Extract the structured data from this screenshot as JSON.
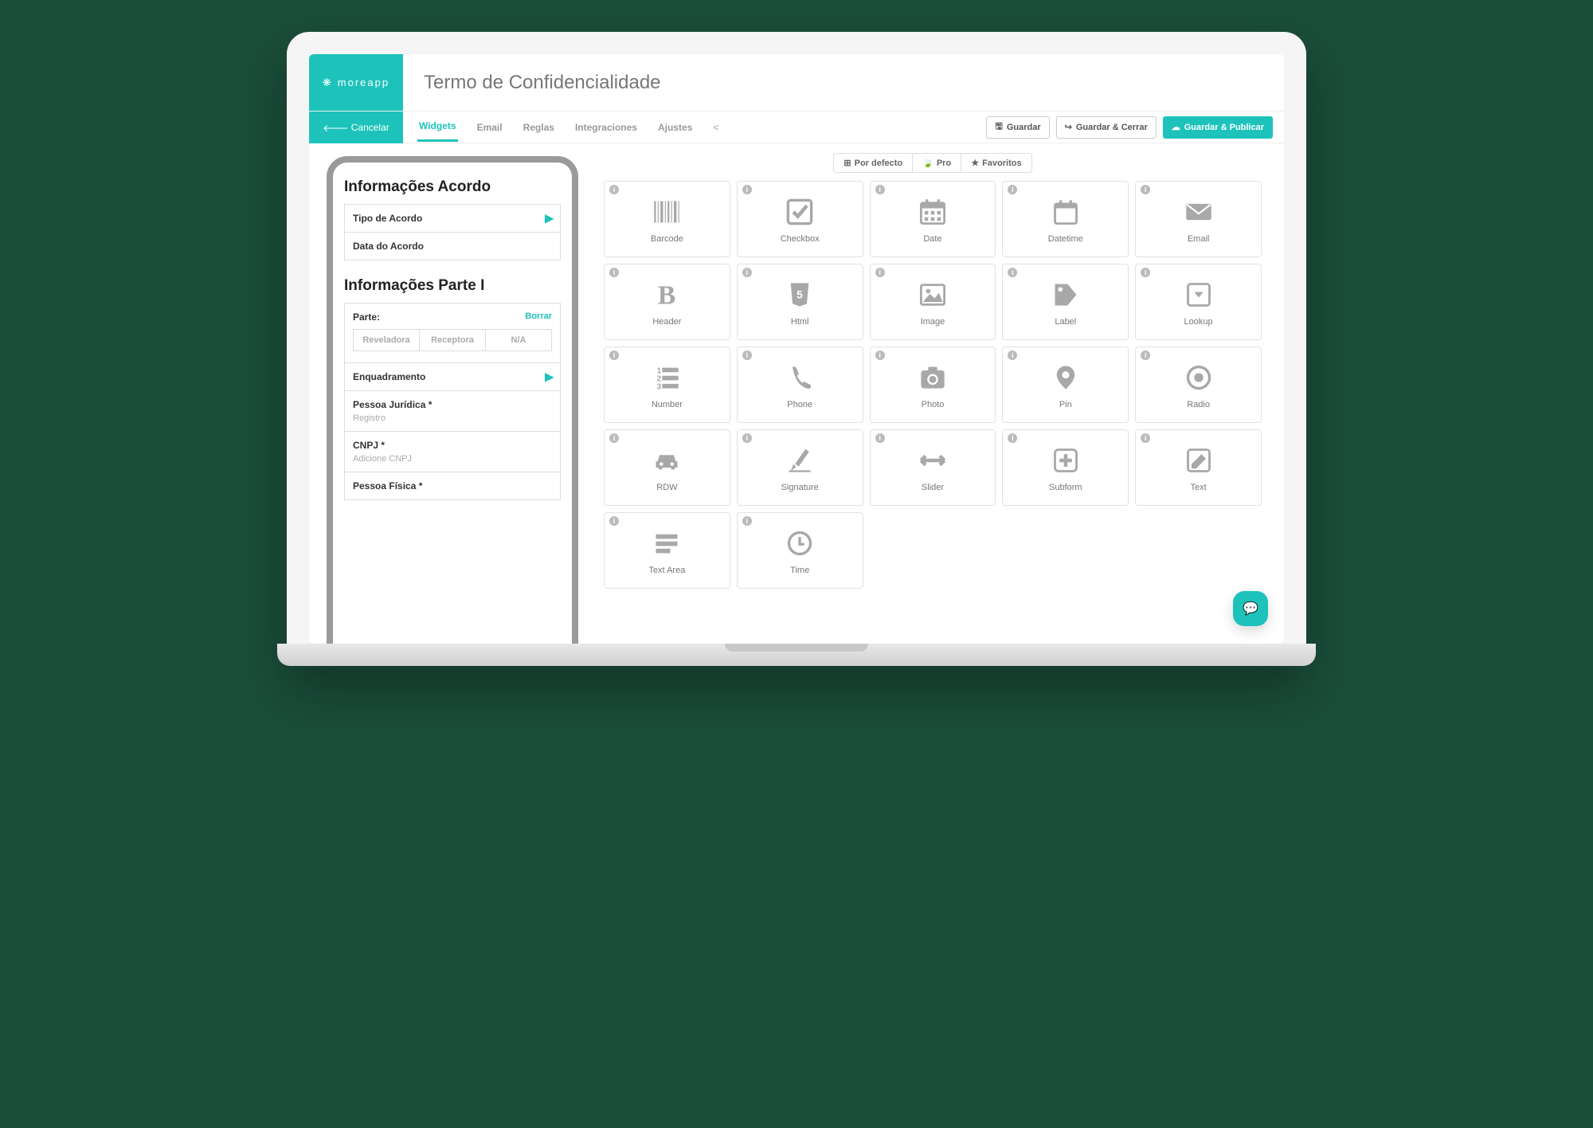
{
  "brand": {
    "name": "moreapp"
  },
  "page_title": "Termo de Confidencialidade",
  "cancel_label": "Cancelar",
  "tabs": {
    "widgets": "Widgets",
    "email": "Email",
    "reglas": "Reglas",
    "integraciones": "Integraciones",
    "ajustes": "Ajustes"
  },
  "actions": {
    "save": "Guardar",
    "save_close": "Guardar & Cerrar",
    "save_publish": "Guardar & Publicar"
  },
  "preview": {
    "section1_title": "Informações Acordo",
    "tipo_acordo": "Tipo de Acordo",
    "data_acordo": "Data do Acordo",
    "section2_title": "Informações Parte I",
    "parte_label": "Parte:",
    "borrar": "Borrar",
    "seg_options": [
      "Reveladora",
      "Receptora",
      "N/A"
    ],
    "enquadramento": "Enquadramento",
    "pessoa_juridica": "Pessoa Jurídica *",
    "registro_placeholder": "Registro",
    "cnpj_label": "CNPJ *",
    "cnpj_placeholder": "Adicione CNPJ",
    "pessoa_fisica": "Pessoa Física *"
  },
  "filters": {
    "default": "Por defecto",
    "pro": "Pro",
    "favoritos": "Favoritos"
  },
  "widgets": [
    {
      "id": "barcode",
      "label": "Barcode"
    },
    {
      "id": "checkbox",
      "label": "Checkbox"
    },
    {
      "id": "date",
      "label": "Date"
    },
    {
      "id": "datetime",
      "label": "Datetime"
    },
    {
      "id": "email",
      "label": "Email"
    },
    {
      "id": "header",
      "label": "Header"
    },
    {
      "id": "html",
      "label": "Html"
    },
    {
      "id": "image",
      "label": "Image"
    },
    {
      "id": "label",
      "label": "Label"
    },
    {
      "id": "lookup",
      "label": "Lookup"
    },
    {
      "id": "number",
      "label": "Number"
    },
    {
      "id": "phone",
      "label": "Phone"
    },
    {
      "id": "photo",
      "label": "Photo"
    },
    {
      "id": "pin",
      "label": "Pin"
    },
    {
      "id": "radio",
      "label": "Radio"
    },
    {
      "id": "rdw",
      "label": "RDW"
    },
    {
      "id": "signature",
      "label": "Signature"
    },
    {
      "id": "slider",
      "label": "Slider"
    },
    {
      "id": "subform",
      "label": "Subform"
    },
    {
      "id": "text",
      "label": "Text"
    },
    {
      "id": "textarea",
      "label": "Text Area"
    },
    {
      "id": "time",
      "label": "Time"
    }
  ]
}
